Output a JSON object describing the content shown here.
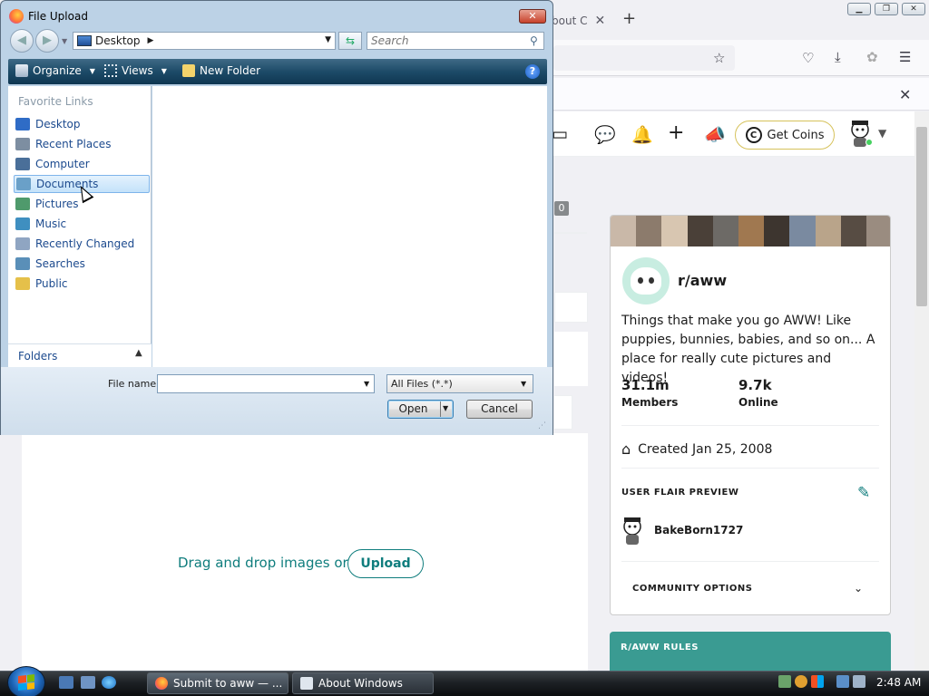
{
  "firefox": {
    "partial_tab_text": "bout C",
    "tab_close": "✕",
    "new_tab": "+",
    "notification_close": "✕"
  },
  "reddit": {
    "header": {
      "get_coins": "Get Coins"
    },
    "count_badge": "0",
    "dropzone": {
      "text": "Drag and drop images or",
      "upload_button": "Upload"
    },
    "community": {
      "name": "r/aww",
      "description": "Things that make you go AWW! Like puppies, bunnies, babies, and so on... A place for really cute pictures and videos!",
      "members_value": "31.1m",
      "members_label": "Members",
      "online_value": "9.7k",
      "online_label": "Online",
      "created": "Created Jan 25, 2008",
      "flair_title": "USER FLAIR PREVIEW",
      "flair_username": "BakeBorn1727",
      "options_title": "COMMUNITY OPTIONS",
      "rules_title": "R/AWW RULES"
    },
    "colors": {
      "teal": "#0f7d7d",
      "rules_bg": "#3a9b92"
    }
  },
  "dialog": {
    "title": "File Upload",
    "address": "Desktop",
    "search_placeholder": "Search",
    "toolbar": {
      "organize": "Organize",
      "views": "Views",
      "new_folder": "New Folder"
    },
    "favorite_links_title": "Favorite Links",
    "favorites": [
      {
        "label": "Desktop",
        "icon": "desktop-icon",
        "color": "#2f6cc6"
      },
      {
        "label": "Recent Places",
        "icon": "recent-places-icon",
        "color": "#7d8ea1"
      },
      {
        "label": "Computer",
        "icon": "computer-icon",
        "color": "#4a6f99"
      },
      {
        "label": "Documents",
        "icon": "documents-icon",
        "color": "#6aa0c8",
        "selected": true
      },
      {
        "label": "Pictures",
        "icon": "pictures-icon",
        "color": "#4f9a6c"
      },
      {
        "label": "Music",
        "icon": "music-icon",
        "color": "#3f8fc0"
      },
      {
        "label": "Recently Changed",
        "icon": "recently-changed-icon",
        "color": "#8fa5c2"
      },
      {
        "label": "Searches",
        "icon": "searches-icon",
        "color": "#5a8fb8"
      },
      {
        "label": "Public",
        "icon": "public-icon",
        "color": "#e5c04a"
      }
    ],
    "folders_label": "Folders",
    "file_name_label": "File name:",
    "file_name_value": "",
    "file_type": "All Files (*.*)",
    "open_button": "Open",
    "cancel_button": "Cancel"
  },
  "taskbar": {
    "tasks": [
      {
        "label": "Submit to aww — ...",
        "active": true
      },
      {
        "label": "About Windows",
        "active": false
      }
    ],
    "clock": "2:48 AM"
  }
}
